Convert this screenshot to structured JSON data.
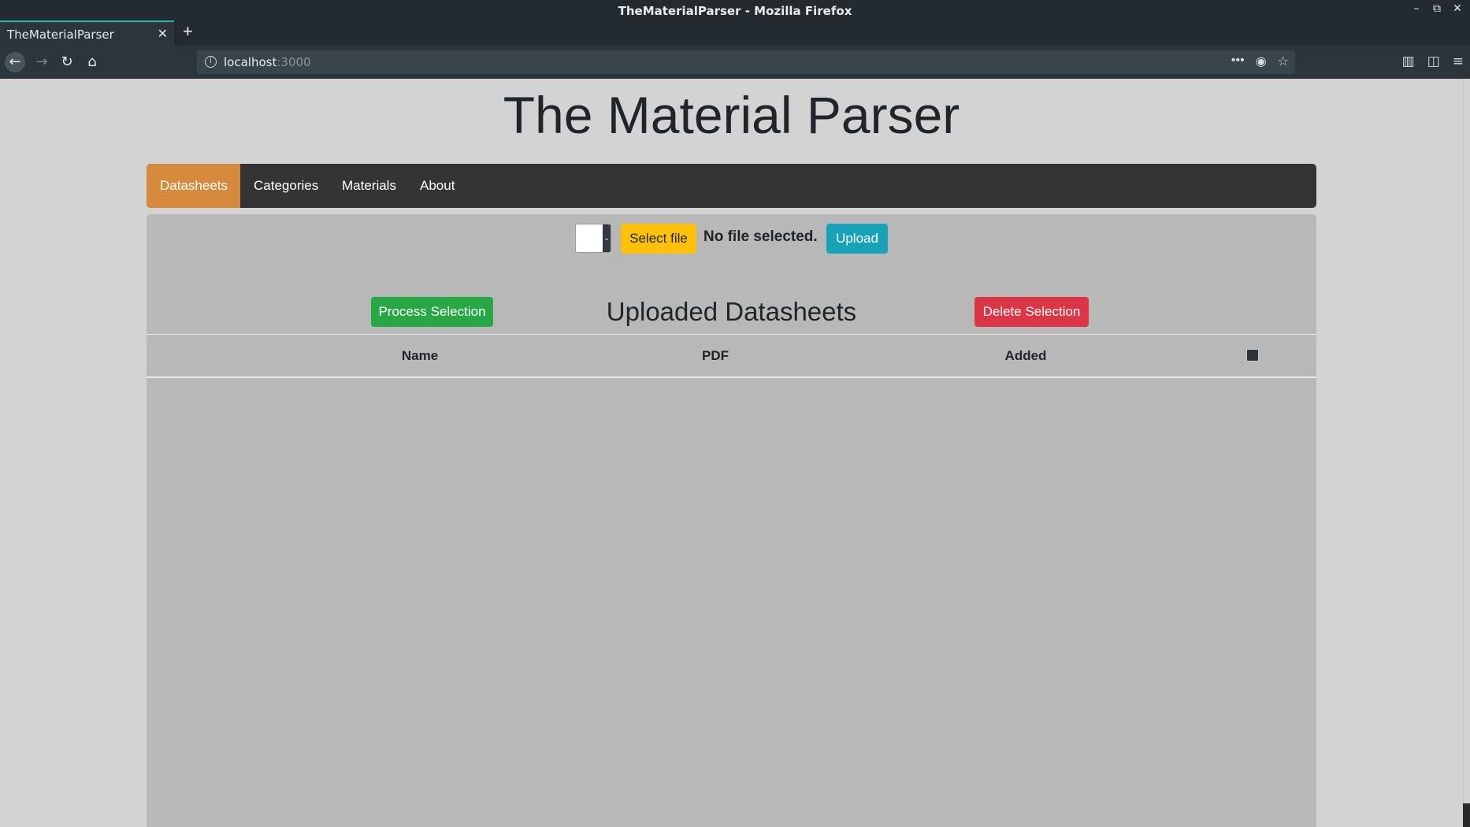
{
  "browser": {
    "window_title": "TheMaterialParser - Mozilla Firefox",
    "tab_title": "TheMaterialParser",
    "url_host": "localhost",
    "url_port": ":3000",
    "new_tab_symbol": "+",
    "tab_close_symbol": "✕"
  },
  "page": {
    "title": "The Material Parser",
    "nav": [
      {
        "label": "Datasheets",
        "active": true
      },
      {
        "label": "Categories",
        "active": false
      },
      {
        "label": "Materials",
        "active": false
      },
      {
        "label": "About",
        "active": false
      }
    ],
    "upload": {
      "select_label": "Select file",
      "status": "No file selected.",
      "upload_label": "Upload"
    },
    "section_title": "Uploaded Datasheets",
    "process_label": "Process Selection",
    "delete_label": "Delete Selection",
    "table": {
      "columns": [
        "Name",
        "PDF",
        "Added"
      ],
      "rows": []
    }
  },
  "colors": {
    "active_nav": "#d68a3c",
    "process": "#28a745",
    "delete": "#dc3545",
    "upload": "#17a2b8",
    "select": "#ffc107"
  }
}
